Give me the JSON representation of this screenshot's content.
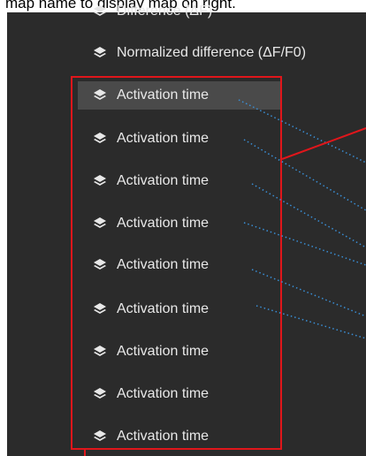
{
  "caption": "map name to display map on right.",
  "menu": {
    "items": [
      {
        "label": "Difference (ΔF)"
      },
      {
        "label": "Normalized difference (ΔF/F0)"
      },
      {
        "label": "Activation time"
      },
      {
        "label": "Activation time"
      },
      {
        "label": "Activation time"
      },
      {
        "label": "Activation time"
      },
      {
        "label": "Activation time"
      },
      {
        "label": "Activation time"
      },
      {
        "label": "Activation time"
      },
      {
        "label": "Activation time"
      },
      {
        "label": "Activation time"
      }
    ],
    "selected_index": 2
  },
  "colors": {
    "panel_bg": "#2b2b2b",
    "selected_bg": "#4a4a4a",
    "text": "#e8e8e8",
    "highlight": "#e0161b",
    "dotted_line": "#3a8fd6"
  },
  "icon": "layers-icon"
}
